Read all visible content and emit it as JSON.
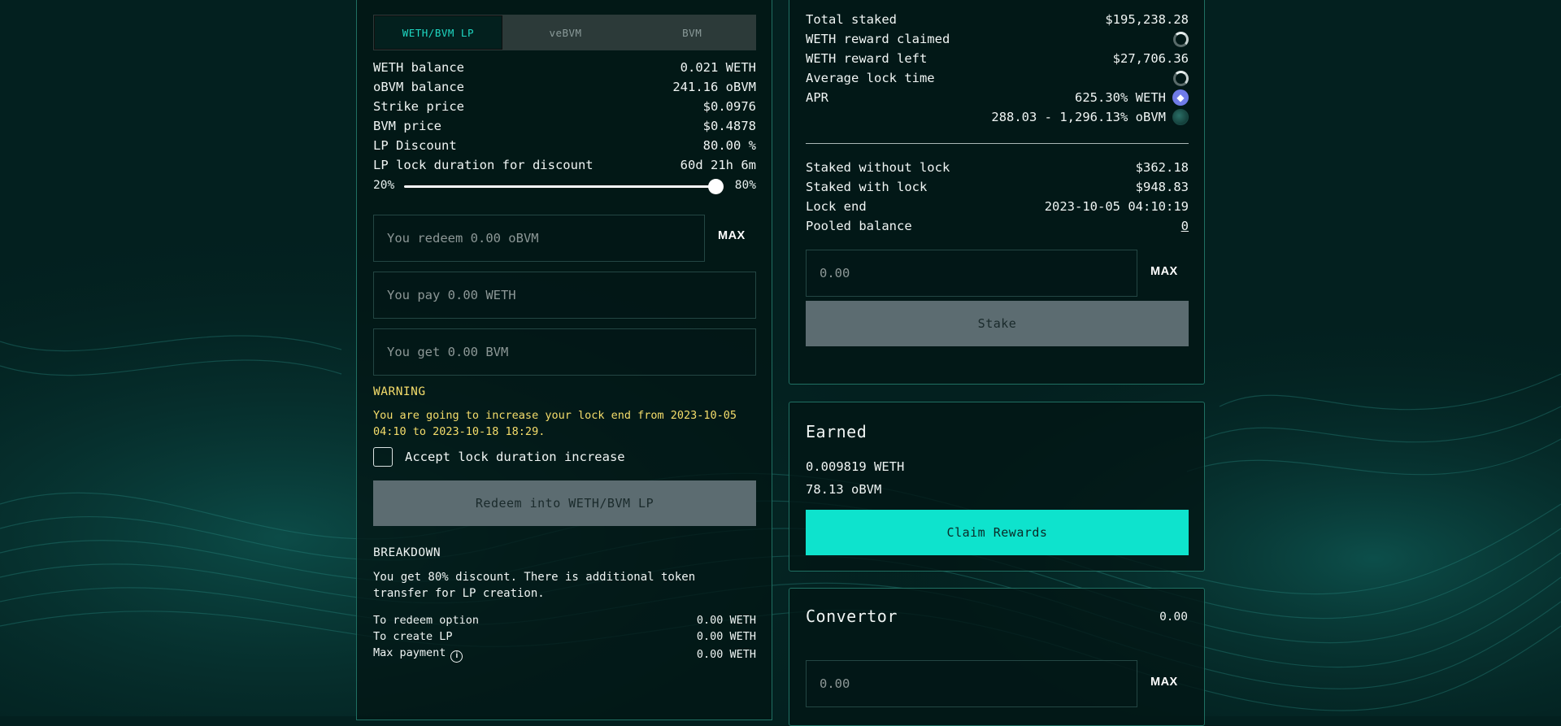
{
  "colors": {
    "accent": "#0ee3cd",
    "warning": "#f5dd6b",
    "panel_border": "#1f6f62",
    "disabled_button": "#5c6c71"
  },
  "tabs": [
    {
      "label": "WETH/BVM LP",
      "active": true
    },
    {
      "label": "veBVM",
      "active": false
    },
    {
      "label": "BVM",
      "active": false
    }
  ],
  "redeem": {
    "rows": [
      {
        "label": "WETH balance",
        "value": "0.021 WETH"
      },
      {
        "label": "oBVM balance",
        "value": "241.16 oBVM"
      },
      {
        "label": "Strike price",
        "value": "$0.0976"
      },
      {
        "label": "BVM price",
        "value": "$0.4878"
      },
      {
        "label": "LP Discount",
        "value": "80.00 %"
      },
      {
        "label": "LP lock duration for discount",
        "value": "60d 21h 6m"
      }
    ],
    "slider": {
      "min_label": "20%",
      "max_label": "80%",
      "level_percent": 100
    },
    "inputs": {
      "redeem_placeholder": "You redeem 0.00 oBVM",
      "pay_placeholder": "You pay 0.00 WETH",
      "get_placeholder": "You get 0.00 BVM"
    },
    "max_label": "MAX",
    "warning_title": "WARNING",
    "warning_text": "You are going to increase your lock end from 2023-10-05 04:10 to 2023-10-18 18:29.",
    "checkbox_label": "Accept lock duration increase",
    "checkbox_checked": false,
    "redeem_button": "Redeem into WETH/BVM LP",
    "breakdown_title": "BREAKDOWN",
    "breakdown_text": "You get 80% discount. There is additional token transfer for LP creation.",
    "breakdown_rows": [
      {
        "label": "To redeem option",
        "value": "0.00 WETH"
      },
      {
        "label": "To create LP",
        "value": "0.00 WETH"
      },
      {
        "label": "Max payment",
        "value": "0.00 WETH"
      }
    ]
  },
  "staking": {
    "total_staked_label": "Total staked",
    "total_staked": "$195,238.28",
    "weth_claimed_label": "WETH reward claimed",
    "weth_left_label": "WETH reward left",
    "weth_left": "$27,706.36",
    "avg_lock_label": "Average lock time",
    "apr_label": "APR",
    "apr_weth": "625.30% WETH",
    "apr_obvm": "288.03 - 1,296.13% oBVM",
    "without_lock_label": "Staked without lock",
    "without_lock": "$362.18",
    "with_lock_label": "Staked with lock",
    "with_lock": "$948.83",
    "lock_end_label": "Lock end",
    "lock_end": "2023-10-05 04:10:19",
    "pooled_label": "Pooled balance",
    "pooled": "0",
    "input_placeholder": "0.00",
    "max_label": "MAX",
    "stake_button": "Stake"
  },
  "earned": {
    "title": "Earned",
    "weth": "0.009819 WETH",
    "obvm": "78.13 oBVM",
    "claim_button": "Claim Rewards"
  },
  "convertor": {
    "title": "Convertor",
    "balance": "0.00",
    "input_placeholder": "0.00",
    "max_label": "MAX"
  }
}
